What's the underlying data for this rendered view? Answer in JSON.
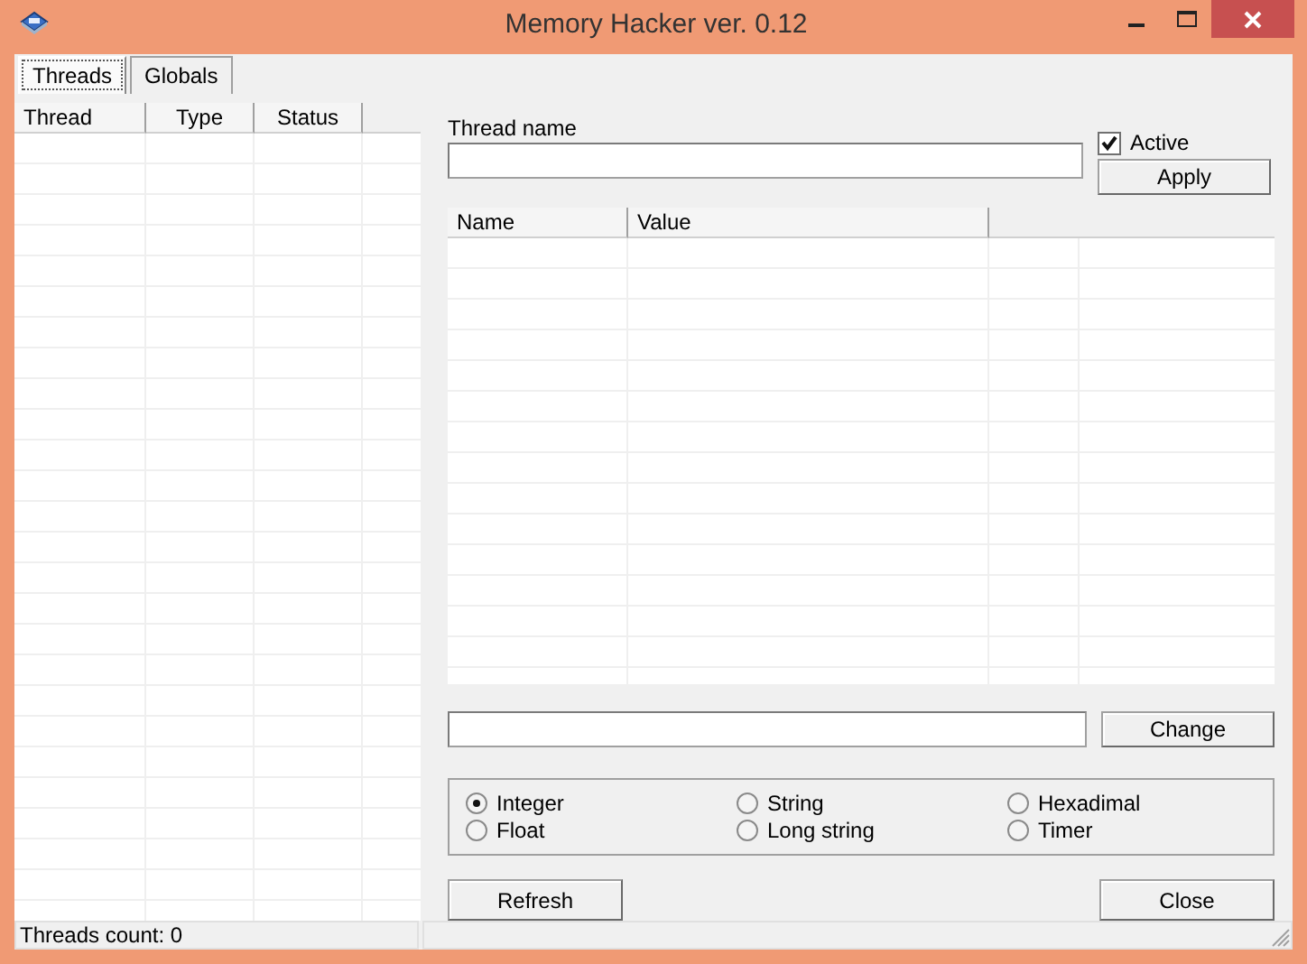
{
  "window": {
    "title": "Memory Hacker ver. 0.12"
  },
  "tabs": [
    {
      "label": "Threads",
      "selected": true
    },
    {
      "label": "Globals",
      "selected": false
    }
  ],
  "threads_table": {
    "columns": [
      "Thread",
      "Type",
      "Status"
    ]
  },
  "thread_name": {
    "label": "Thread name"
  },
  "active": {
    "label": "Active",
    "checked": true
  },
  "apply_button": "Apply",
  "values_table": {
    "columns": [
      "Name",
      "Value"
    ]
  },
  "change_button": "Change",
  "value_types": [
    {
      "label": "Integer",
      "selected": true
    },
    {
      "label": "String",
      "selected": false
    },
    {
      "label": "Hexadimal",
      "selected": false
    },
    {
      "label": "Float",
      "selected": false
    },
    {
      "label": "Long string",
      "selected": false
    },
    {
      "label": "Timer",
      "selected": false
    }
  ],
  "buttons": [
    "Refresh",
    "Close"
  ],
  "status_bar": {
    "text": "Threads count: 0"
  }
}
